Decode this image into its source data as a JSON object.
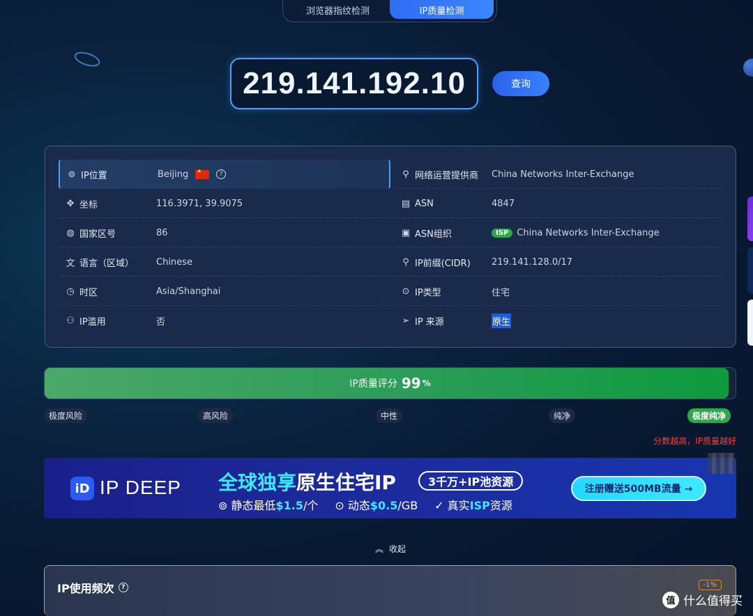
{
  "tabs": [
    {
      "label": "浏览器指纹检测",
      "active": false
    },
    {
      "label": "IP质量检测",
      "active": true
    }
  ],
  "search": {
    "ip": "219.141.192.10",
    "button": "查询"
  },
  "info": {
    "left": [
      {
        "icon": "location-pin-icon",
        "label": "IP位置",
        "value": "Beijing"
      },
      {
        "icon": "crosshair-icon",
        "label": "坐标",
        "value": "116.3971, 39.9075"
      },
      {
        "icon": "globe-icon",
        "label": "国家区号",
        "value": "86"
      },
      {
        "icon": "translate-icon",
        "label": "语言（区域）",
        "value": "Chinese"
      },
      {
        "icon": "clock-icon",
        "label": "时区",
        "value": "Asia/Shanghai"
      },
      {
        "icon": "user-check-icon",
        "label": "IP滥用",
        "value": "否"
      }
    ],
    "right": [
      {
        "icon": "user-network-icon",
        "label": "网络运营提供商",
        "value": "China Networks Inter-Exchange"
      },
      {
        "icon": "id-card-icon",
        "label": "ASN",
        "value": "4847"
      },
      {
        "icon": "org-card-icon",
        "label": "ASN组织",
        "badge": "ISP",
        "value": "China Networks Inter-Exchange"
      },
      {
        "icon": "user-icon",
        "label": "IP前缀(CIDR)",
        "value": "219.141.128.0/17"
      },
      {
        "icon": "bulb-pin-icon",
        "label": "IP类型",
        "value": "住宅"
      },
      {
        "icon": "cursor-arrow-icon",
        "label": "IP 来源",
        "value": "原生"
      }
    ]
  },
  "score": {
    "label": "IP质量评分",
    "value": "99",
    "unit": "%",
    "fraction": 0.99
  },
  "levels": [
    "极度风险",
    "高风险",
    "中性",
    "纯净",
    "极度纯净"
  ],
  "hint": "分数越高，IP质量越好",
  "banner": {
    "logo_letter": "iD",
    "brand": "IP DEEP",
    "headline_a": "全球独享",
    "headline_b": "原生住宅IP",
    "pool": "3千万+IP池资源",
    "static_a": "静态最低",
    "static_price": "$1.5",
    "static_b": "/个",
    "dynamic_a": "动态",
    "dynamic_price": "$0.5",
    "dynamic_b": "/GB",
    "real_a": "真实",
    "real_isp": "ISP",
    "real_b": "资源",
    "cta": "注册赠送500MB流量 →"
  },
  "collapse": "收起",
  "frequency": {
    "title": "IP使用频次",
    "pct": "-1%"
  },
  "watermark": "什么值得买",
  "watermark_logo": "值"
}
